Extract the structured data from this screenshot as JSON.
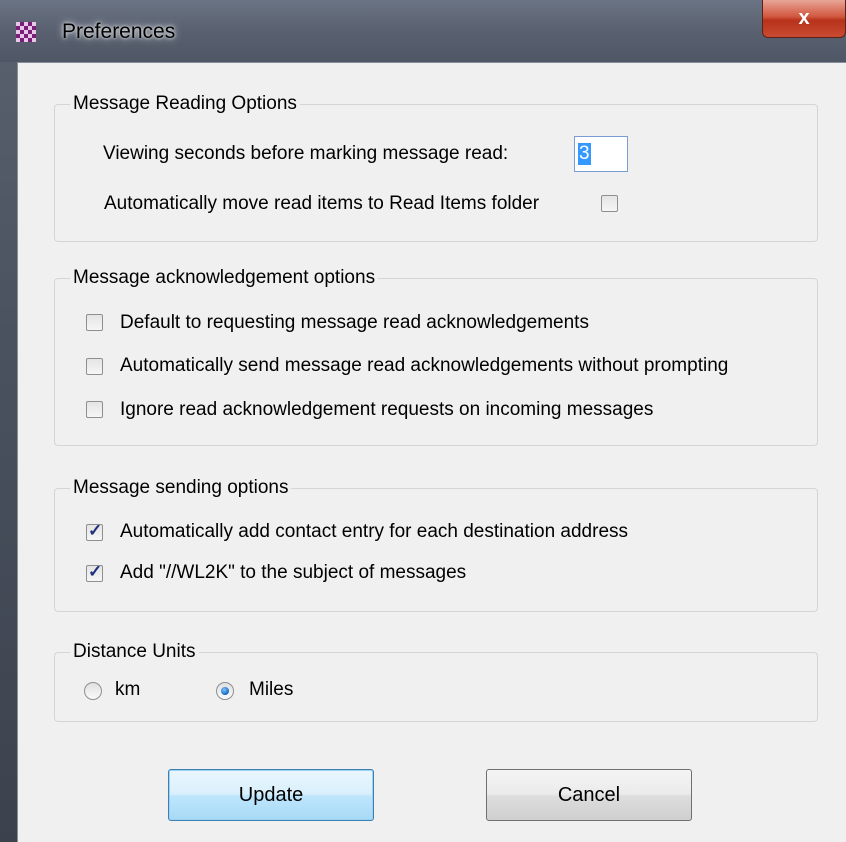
{
  "window": {
    "title": "Preferences",
    "close_label": "x"
  },
  "reading": {
    "label": "Message Reading Options",
    "seconds_label": "Viewing seconds before marking message read:",
    "seconds_value": "3",
    "auto_move_label": "Automatically move read items to Read Items folder",
    "auto_move_checked": false
  },
  "ack": {
    "label": "Message acknowledgement options",
    "items": [
      {
        "label": "Default to requesting message read acknowledgements",
        "checked": false
      },
      {
        "label": "Automatically send message read acknowledgements without prompting",
        "checked": false
      },
      {
        "label": "Ignore read acknowledgement requests on incoming messages",
        "checked": false
      }
    ]
  },
  "sending": {
    "label": "Message sending options",
    "items": [
      {
        "label": "Automatically add contact entry for each destination address",
        "checked": true
      },
      {
        "label": "Add \"//WL2K\" to the subject of messages",
        "checked": true
      }
    ]
  },
  "units": {
    "label": "Distance Units",
    "options": [
      {
        "label": "km",
        "selected": false
      },
      {
        "label": "Miles",
        "selected": true
      }
    ]
  },
  "buttons": {
    "update": "Update",
    "cancel": "Cancel"
  }
}
